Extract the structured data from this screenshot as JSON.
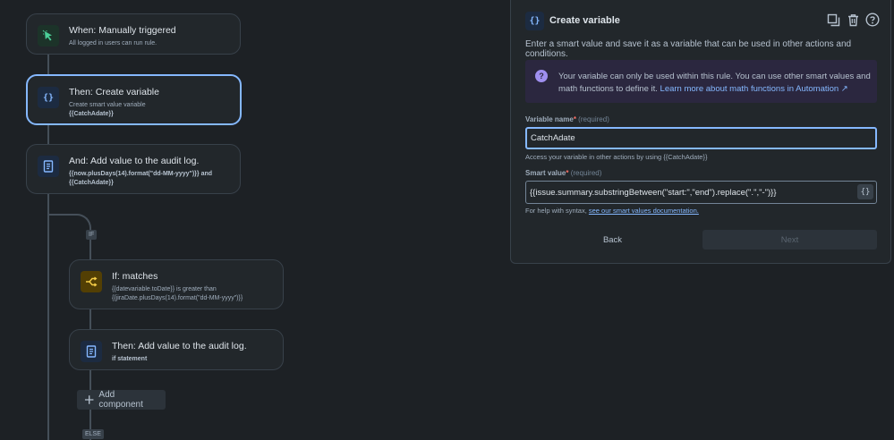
{
  "flow": {
    "trigger": {
      "title": "When: Manually triggered",
      "sub": "All logged in users can run rule."
    },
    "create_var": {
      "title": "Then: Create variable",
      "sub": "Create smart value variable",
      "var": "{{CatchAdate}}"
    },
    "audit1": {
      "title": "And: Add value to the audit log.",
      "value": "{{now.plusDays(14).format(\"dd-MM-yyyy\")}} and {{CatchAdate}}"
    },
    "if_tag": "IF",
    "if_matches": {
      "title": "If: matches",
      "line1": "{{datevariable.toDate}} is greater than",
      "line2": "{{jiraDate.plusDays(14).format(\"dd-MM-yyyy\")}}"
    },
    "audit2": {
      "title": "Then: Add value to the audit log.",
      "value": "if statement"
    },
    "add_component": "Add component",
    "else_tag": "ELSE"
  },
  "panel": {
    "title": "Create variable",
    "description": "Enter a smart value and save it as a variable that can be used in other actions and conditions.",
    "info_text": "Your variable can only be used within this rule. You can use other smart values and math functions to define it.",
    "info_link": "Learn more about math functions in Automation ↗",
    "variable_name": {
      "label": "Variable name",
      "required_mark": "*",
      "optional": "(required)",
      "value": "CatchAdate",
      "hint": "Access your variable in other actions by using {{CatchAdate}}"
    },
    "smart_value": {
      "label": "Smart value",
      "required_mark": "*",
      "optional": "(required)",
      "value": "{{issue.summary.substringBetween(\"start:\",\"end\").replace(\".\",\"-\")}}",
      "brace_button": "{}",
      "hint_prefix": "For help with syntax,",
      "hint_link": "see our smart values documentation."
    },
    "back_label": "Back",
    "next_label": "Next"
  },
  "colors": {
    "accent": "#85b8ff",
    "background": "#1d2125",
    "card": "#22272b"
  },
  "icons": [
    "cursor-click-icon",
    "braces-icon",
    "document-icon",
    "branch-icon",
    "copy-icon",
    "trash-icon",
    "help-icon",
    "question-icon",
    "plus-icon"
  ]
}
